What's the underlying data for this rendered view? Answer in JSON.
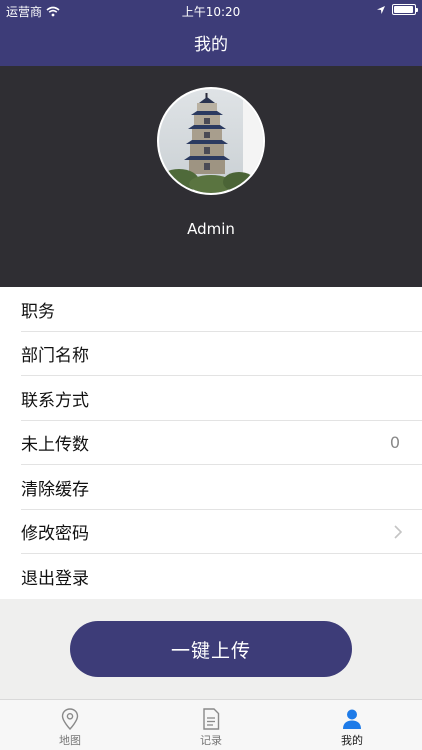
{
  "status_bar": {
    "carrier": "运营商",
    "time": "上午10:20"
  },
  "nav": {
    "title": "我的"
  },
  "profile": {
    "username": "Admin"
  },
  "menu": [
    {
      "label": "职务",
      "value": ""
    },
    {
      "label": "部门名称",
      "value": ""
    },
    {
      "label": "联系方式",
      "value": ""
    },
    {
      "label": "未上传数",
      "value": "0"
    },
    {
      "label": "清除缓存",
      "value": ""
    },
    {
      "label": "修改密码",
      "value": ""
    },
    {
      "label": "退出登录",
      "value": ""
    }
  ],
  "upload_button": {
    "label": "一键上传"
  },
  "tabs": [
    {
      "label": "地图",
      "icon": "map-pin-icon"
    },
    {
      "label": "记录",
      "icon": "document-icon"
    },
    {
      "label": "我的",
      "icon": "user-icon",
      "active": true
    }
  ],
  "colors": {
    "primary": "#3d3c78",
    "header_bg": "#2f2e33",
    "active_tab_icon": "#1e7be8"
  }
}
